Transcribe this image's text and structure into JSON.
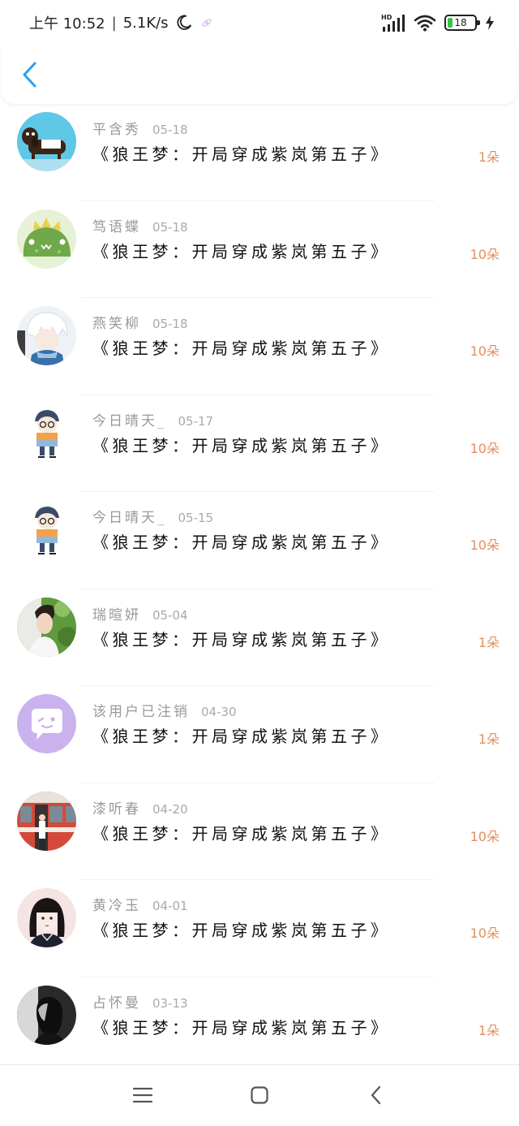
{
  "status_bar": {
    "time": "上午 10:52",
    "separator": "|",
    "network_speed": "5.1K/s",
    "battery_level": "18",
    "signal_label": "HD",
    "icons": [
      "moon-icon",
      "satellite-icon",
      "signal-icon",
      "wifi-icon",
      "battery-icon",
      "charging-icon"
    ]
  },
  "header": {
    "back_icon": "chevron-left-icon"
  },
  "colors": {
    "accent": "#2a9fe8",
    "count": "#e0905e",
    "name": "#999999",
    "title": "#111111"
  },
  "list": {
    "items": [
      {
        "name": "平含秀",
        "date": "05-18",
        "book": "《狼王梦：开局穿成紫岚第五子》",
        "count": "1朵",
        "avatar": "dog-avatar"
      },
      {
        "name": "笃语蝶",
        "date": "05-18",
        "book": "《狼王梦：开局穿成紫岚第五子》",
        "count": "10朵",
        "avatar": "green-dino-avatar"
      },
      {
        "name": "燕笑柳",
        "date": "05-18",
        "book": "《狼王梦：开局穿成紫岚第五子》",
        "count": "10朵",
        "avatar": "anime-boy-avatar"
      },
      {
        "name": "今日晴天_",
        "date": "05-17",
        "book": "《狼王梦：开局穿成紫岚第五子》",
        "count": "10朵",
        "avatar": "cartoon-kid-avatar"
      },
      {
        "name": "今日晴天_",
        "date": "05-15",
        "book": "《狼王梦：开局穿成紫岚第五子》",
        "count": "10朵",
        "avatar": "cartoon-kid-avatar"
      },
      {
        "name": "瑞暄妍",
        "date": "05-04",
        "book": "《狼王梦：开局穿成紫岚第五子》",
        "count": "1朵",
        "avatar": "photo-man-avatar"
      },
      {
        "name": "该用户已注销",
        "date": "04-30",
        "book": "《狼王梦：开局穿成紫岚第五子》",
        "count": "1朵",
        "avatar": "chat-bubble-avatar"
      },
      {
        "name": "漆听春",
        "date": "04-20",
        "book": "《狼王梦：开局穿成紫岚第五子》",
        "count": "10朵",
        "avatar": "train-photo-avatar"
      },
      {
        "name": "黄冷玉",
        "date": "04-01",
        "book": "《狼王梦：开局穿成紫岚第五子》",
        "count": "10朵",
        "avatar": "anime-girl-avatar"
      },
      {
        "name": "占怀曼",
        "date": "03-13",
        "book": "《狼王梦：开局穿成紫岚第五子》",
        "count": "1朵",
        "avatar": "bw-girl-avatar"
      }
    ]
  },
  "nav": {
    "icons": [
      "menu-icon",
      "home-icon",
      "back-icon"
    ]
  }
}
